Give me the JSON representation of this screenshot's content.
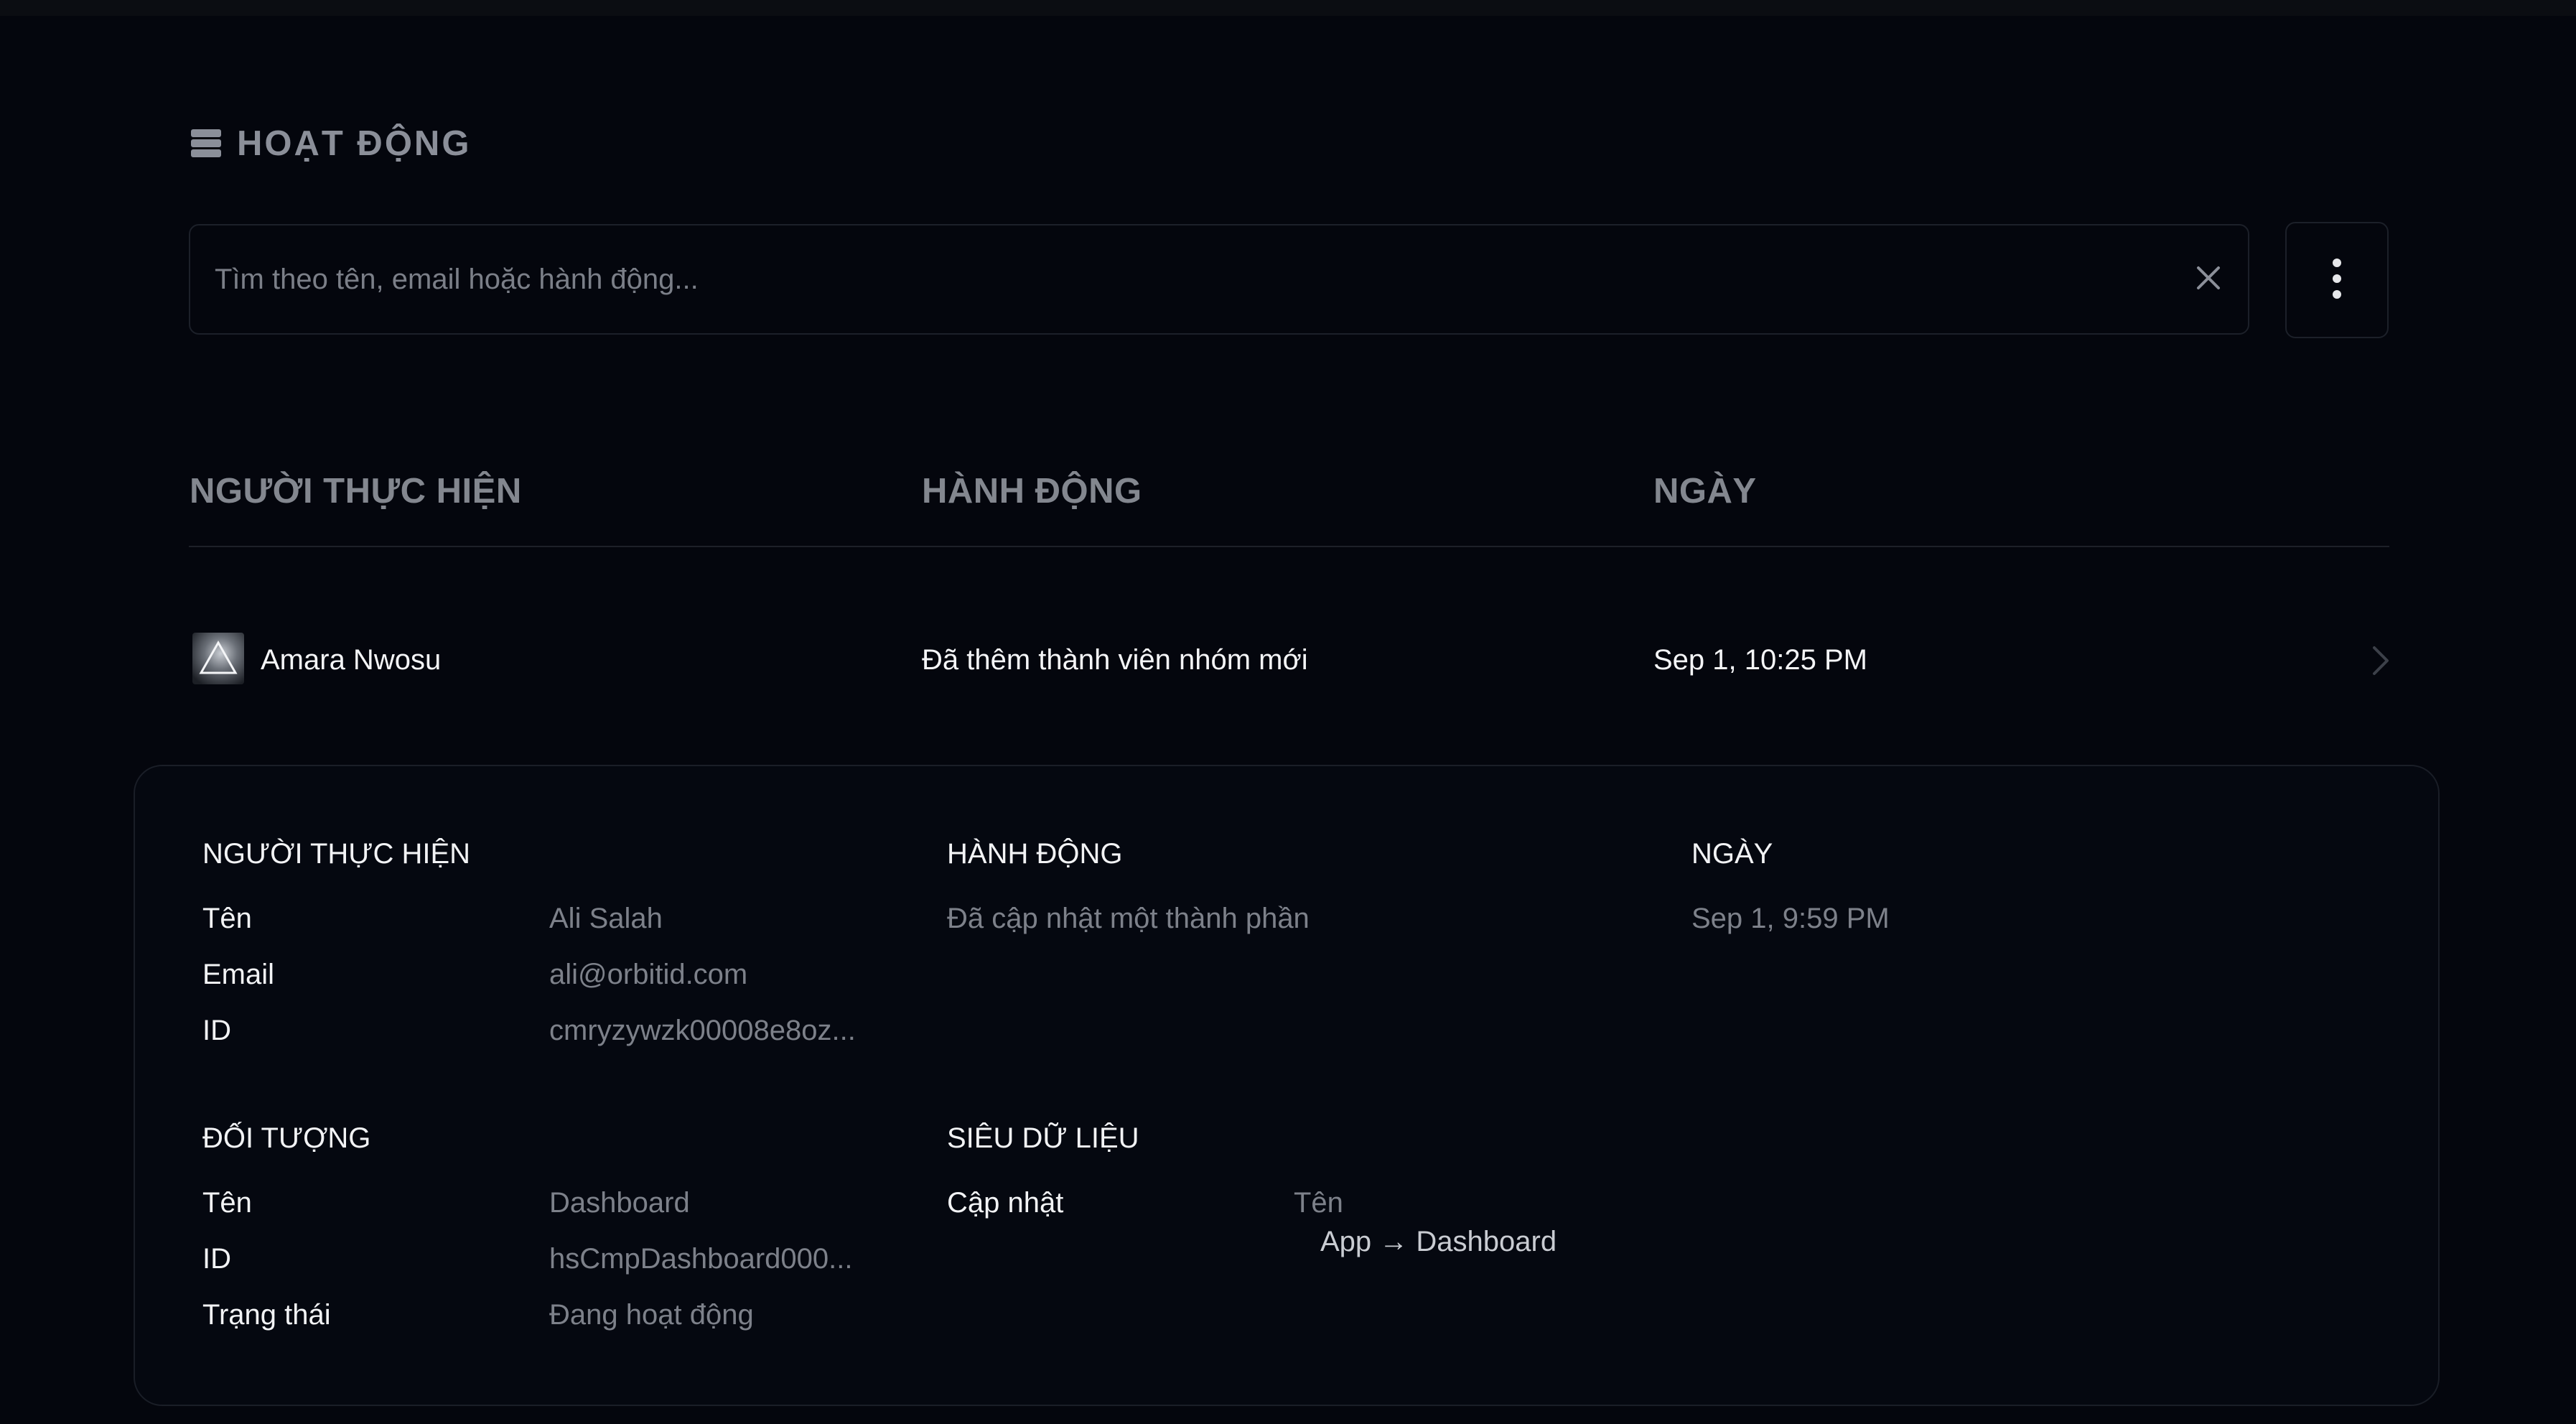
{
  "section": {
    "title": "HOẠT ĐỘNG",
    "icon": "stack-icon"
  },
  "search": {
    "placeholder": "Tìm theo tên, email hoặc hành động...",
    "value": ""
  },
  "table": {
    "columns": [
      "NGƯỜI THỰC HIỆN",
      "HÀNH ĐỘNG",
      "NGÀY"
    ],
    "rows": [
      {
        "actor": "Amara Nwosu",
        "action": "Đã thêm thành viên nhóm mới",
        "date": "Sep 1, 10:25 PM"
      }
    ]
  },
  "detail": {
    "actor": {
      "heading": "NGƯỜI THỰC HIỆN",
      "name_label": "Tên",
      "name": "Ali Salah",
      "email_label": "Email",
      "email": "ali@orbitid.com",
      "id_label": "ID",
      "id": "cmryzywzk00008e8oz..."
    },
    "action": {
      "heading": "HÀNH ĐỘNG",
      "value": "Đã cập nhật một thành phần"
    },
    "date": {
      "heading": "NGÀY",
      "value": "Sep 1, 9:59 PM"
    },
    "object": {
      "heading": "ĐỐI TƯỢNG",
      "name_label": "Tên",
      "name": "Dashboard",
      "id_label": "ID",
      "id": "hsCmpDashboard000...",
      "status_label": "Trạng thái",
      "status": "Đang hoạt động"
    },
    "metadata": {
      "heading": "SIÊU DỮ LIỆU",
      "update_label": "Cập nhật",
      "field": "Tên",
      "from": "App",
      "arrow": "→",
      "to": "Dashboard"
    }
  }
}
